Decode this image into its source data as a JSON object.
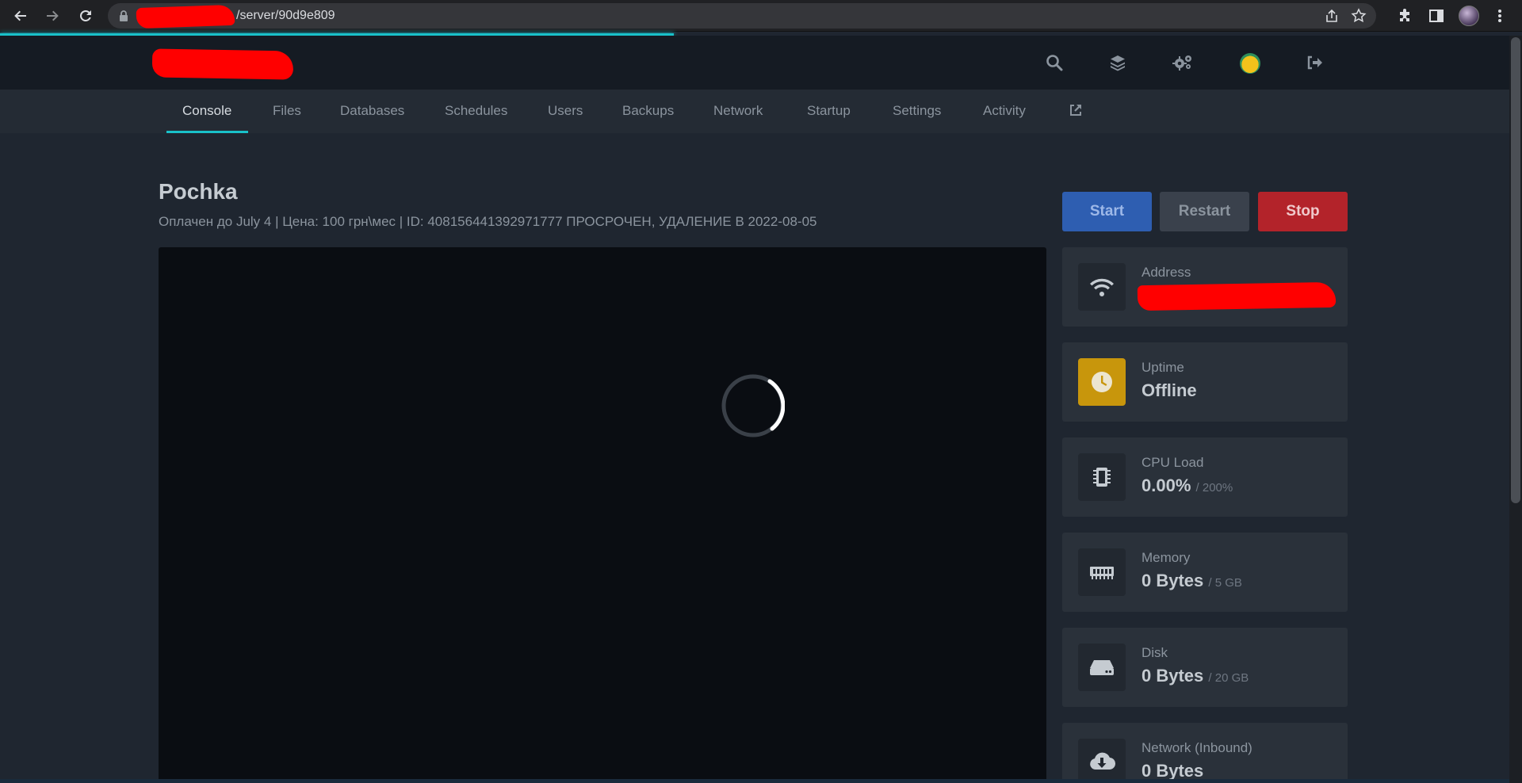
{
  "browser": {
    "url_path": "/server/90d9e809"
  },
  "nav": {
    "tabs": [
      {
        "label": "Console"
      },
      {
        "label": "Files"
      },
      {
        "label": "Databases"
      },
      {
        "label": "Schedules"
      },
      {
        "label": "Users"
      },
      {
        "label": "Backups"
      },
      {
        "label": "Network"
      },
      {
        "label": "Startup"
      },
      {
        "label": "Settings"
      },
      {
        "label": "Activity"
      }
    ],
    "active_tab": "Console"
  },
  "server": {
    "name": "Pochka",
    "description": "Оплачен до July 4 | Цена: 100 грн\\мес | ID: 408156441392971777 ПРОСРОЧЕН, УДАЛЕНИЕ В 2022-08-05"
  },
  "power": {
    "start": "Start",
    "restart": "Restart",
    "stop": "Stop"
  },
  "stats": {
    "address": {
      "label": "Address"
    },
    "uptime": {
      "label": "Uptime",
      "value": "Offline"
    },
    "cpu": {
      "label": "CPU Load",
      "value": "0.00%",
      "limit": "/ 200%"
    },
    "memory": {
      "label": "Memory",
      "value": "0 Bytes",
      "limit": "/ 5 GB"
    },
    "disk": {
      "label": "Disk",
      "value": "0 Bytes",
      "limit": "/ 20 GB"
    },
    "network_in": {
      "label": "Network (Inbound)",
      "value": "0 Bytes"
    }
  },
  "icons": {
    "back": "arrow-left-icon",
    "forward": "arrow-right-icon",
    "reload": "reload-icon",
    "search": "search-icon",
    "servers": "layers-icon",
    "admin": "cogs-icon",
    "logout": "logout-icon",
    "external": "external-link-icon"
  },
  "colors": {
    "accent": "#19c1c9",
    "start": "#2e5eb1",
    "stop": "#b3232a",
    "uptime_icon_bg": "#c8960c"
  }
}
